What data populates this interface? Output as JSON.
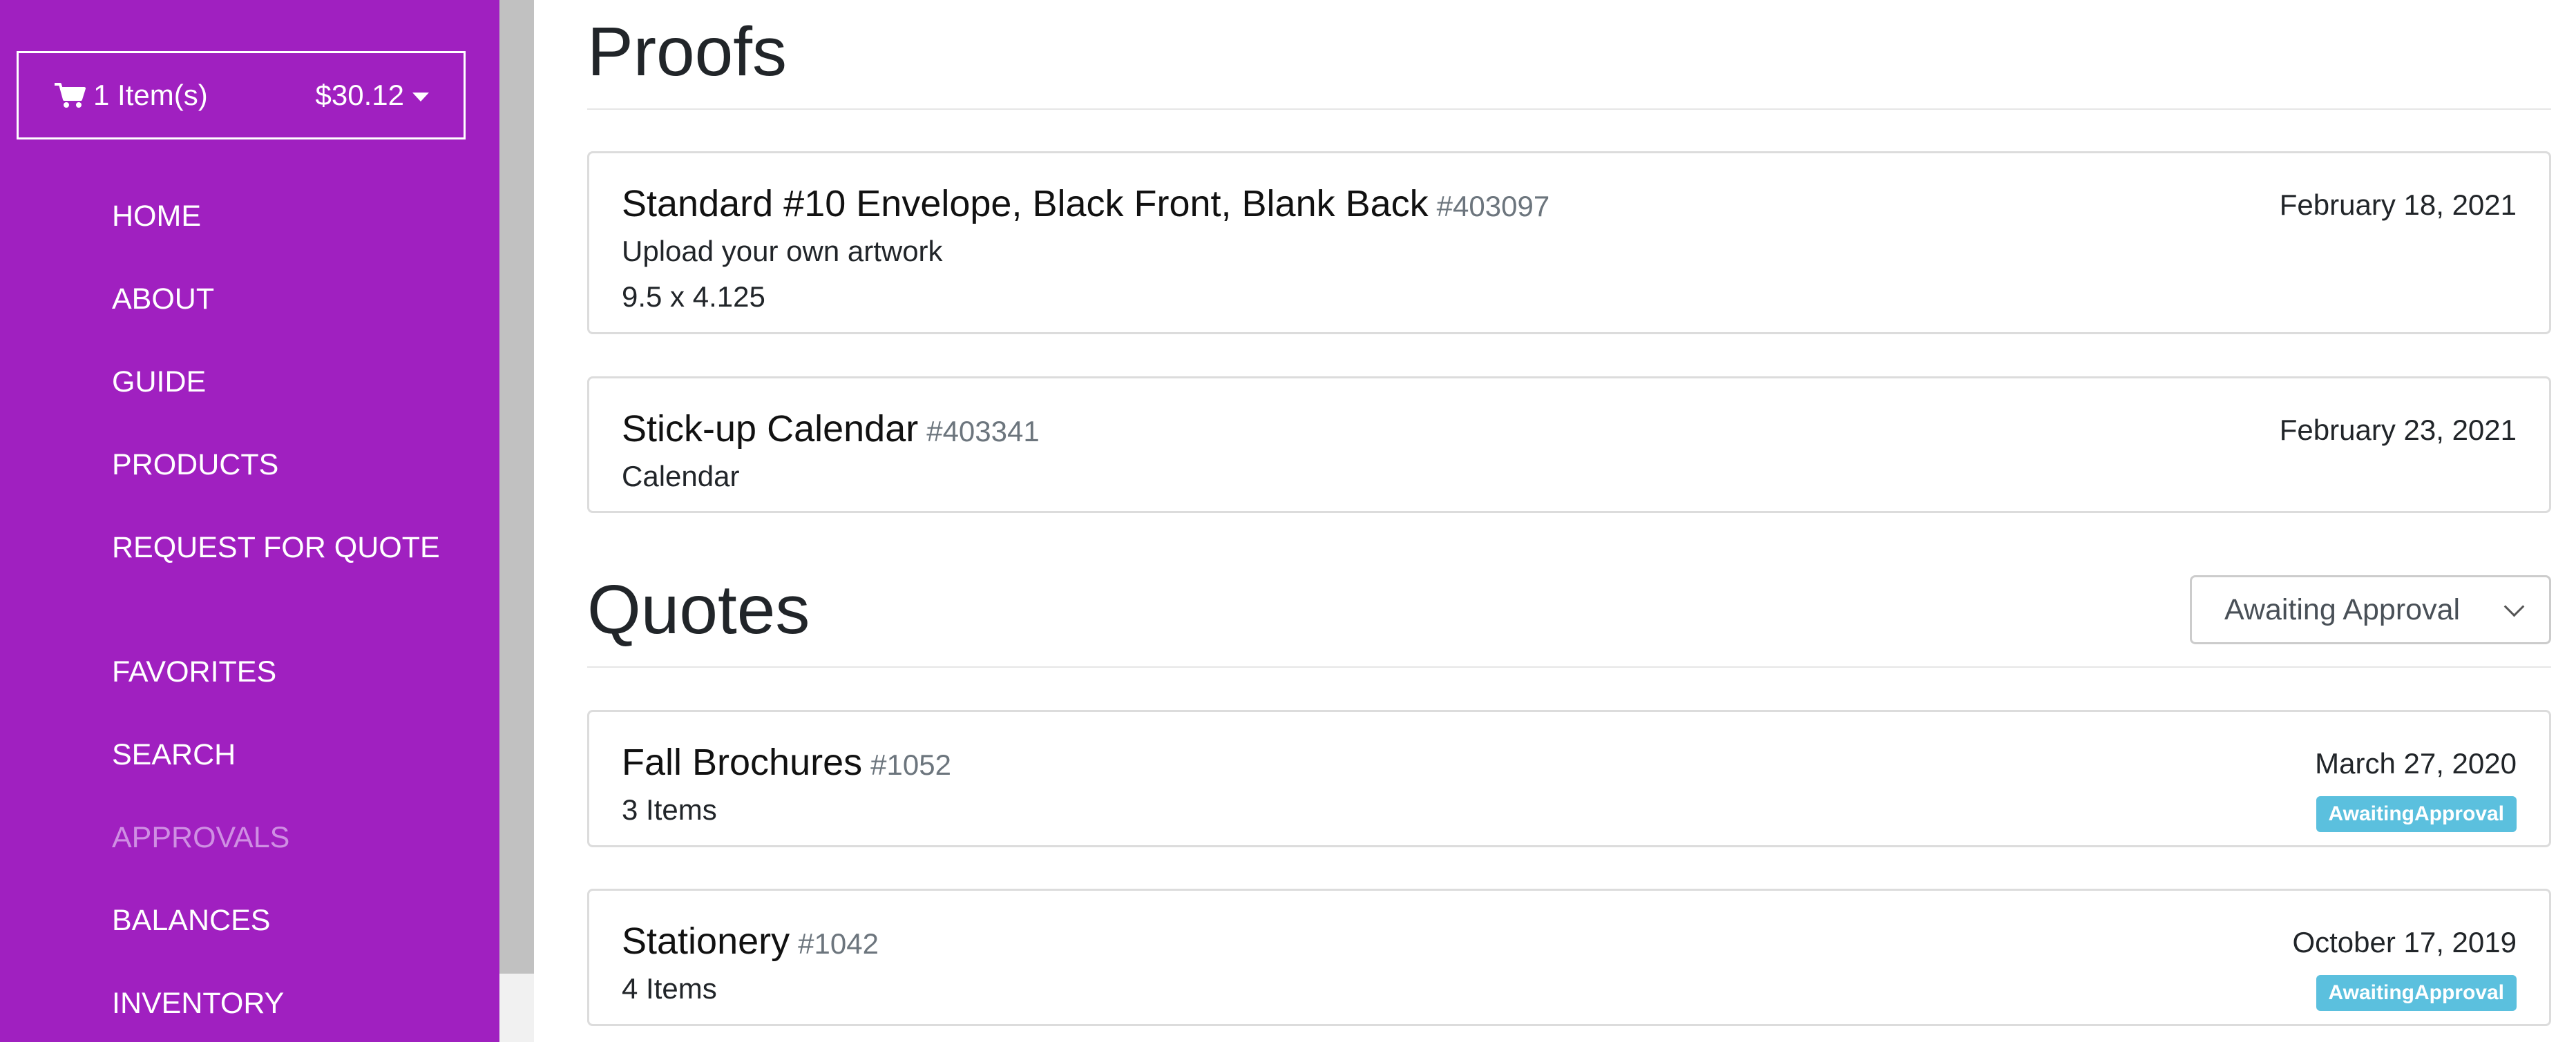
{
  "cart": {
    "count_label": "1 Item(s)",
    "total": "$30.12",
    "icon": "shopping-cart-icon"
  },
  "nav": {
    "items": [
      {
        "label": "HOME"
      },
      {
        "label": "ABOUT"
      },
      {
        "label": "GUIDE"
      },
      {
        "label": "PRODUCTS"
      },
      {
        "label": "REQUEST FOR QUOTE"
      },
      {
        "label": "FAVORITES"
      },
      {
        "label": "SEARCH"
      },
      {
        "label": "APPROVALS",
        "active": true
      },
      {
        "label": "BALANCES"
      },
      {
        "label": "INVENTORY"
      }
    ]
  },
  "proofs": {
    "title": "Proofs",
    "items": [
      {
        "title": "Standard #10 Envelope, Black Front, Blank Back",
        "number": "#403097",
        "lines": [
          "Upload your own artwork",
          "9.5 x 4.125"
        ],
        "date": "February 18, 2021"
      },
      {
        "title": "Stick-up Calendar",
        "number": "#403341",
        "lines": [
          "Calendar"
        ],
        "date": "February 23, 2021"
      }
    ]
  },
  "quotes": {
    "title": "Quotes",
    "filter": {
      "selected": "Awaiting Approval"
    },
    "items": [
      {
        "title": "Fall Brochures",
        "number": "#1052",
        "summary": "3 Items",
        "date": "March 27, 2020",
        "status": "AwaitingApproval"
      },
      {
        "title": "Stationery",
        "number": "#1042",
        "summary": "4 Items",
        "date": "October 17, 2019",
        "status": "AwaitingApproval"
      }
    ]
  },
  "colors": {
    "sidebar": "#a020c0",
    "active_nav": "#cf8fe3",
    "badge": "#5bc0de"
  }
}
